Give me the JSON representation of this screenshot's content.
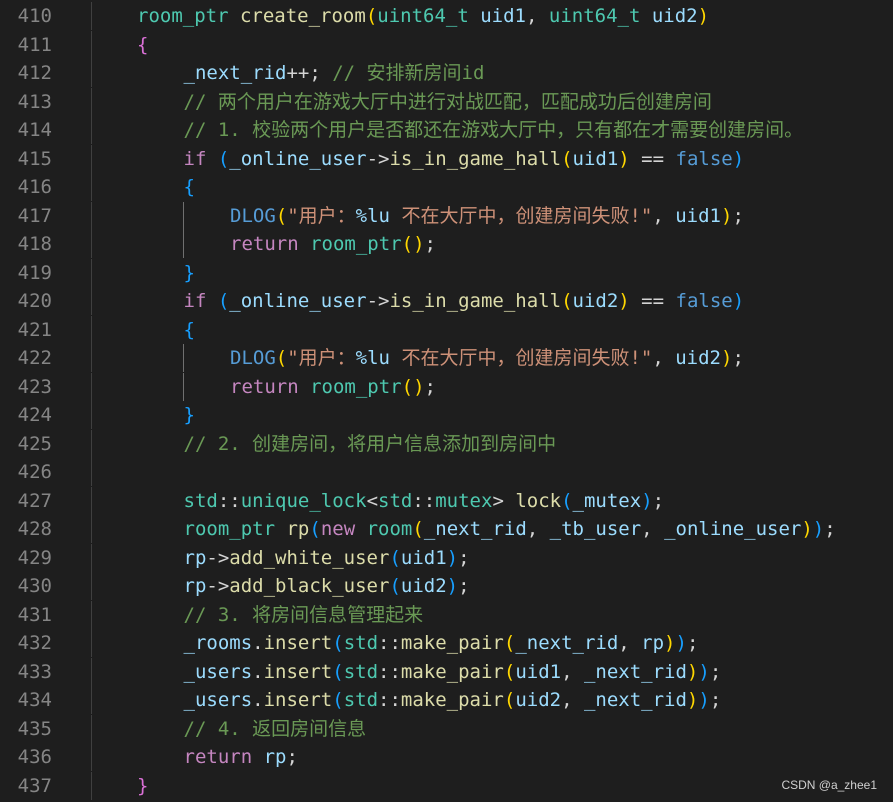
{
  "watermark": "CSDN @a_zhee1",
  "lines": [
    {
      "n": "410",
      "indent": 0,
      "tokens": [
        [
          "room_ptr",
          "type"
        ],
        [
          " ",
          "op"
        ],
        [
          "create_room",
          "func"
        ],
        [
          "(",
          "b1"
        ],
        [
          "uint64_t",
          "type"
        ],
        [
          " ",
          "op"
        ],
        [
          "uid1",
          "var"
        ],
        [
          ", ",
          "op"
        ],
        [
          "uint64_t",
          "type"
        ],
        [
          " ",
          "op"
        ],
        [
          "uid2",
          "var"
        ],
        [
          ")",
          "b1"
        ]
      ]
    },
    {
      "n": "411",
      "indent": 0,
      "tokens": [
        [
          "{",
          "b2"
        ]
      ]
    },
    {
      "n": "412",
      "indent": 1,
      "tokens": [
        [
          "_next_rid",
          "var"
        ],
        [
          "++; ",
          "op"
        ],
        [
          "// 安排新房间id",
          "cmt"
        ]
      ]
    },
    {
      "n": "413",
      "indent": 1,
      "tokens": [
        [
          "// 两个用户在游戏大厅中进行对战匹配，匹配成功后创建房间",
          "cmt"
        ]
      ]
    },
    {
      "n": "414",
      "indent": 1,
      "tokens": [
        [
          "// 1. 校验两个用户是否都还在游戏大厅中，只有都在才需要创建房间。",
          "cmt"
        ]
      ]
    },
    {
      "n": "415",
      "indent": 1,
      "tokens": [
        [
          "if",
          "kw"
        ],
        [
          " ",
          "op"
        ],
        [
          "(",
          "b3"
        ],
        [
          "_online_user",
          "var"
        ],
        [
          "->",
          "op"
        ],
        [
          "is_in_game_hall",
          "func"
        ],
        [
          "(",
          "b1"
        ],
        [
          "uid1",
          "var"
        ],
        [
          ")",
          "b1"
        ],
        [
          " == ",
          "op"
        ],
        [
          "false",
          "bool"
        ],
        [
          ")",
          "b3"
        ]
      ]
    },
    {
      "n": "416",
      "indent": 1,
      "tokens": [
        [
          "{",
          "b3"
        ]
      ]
    },
    {
      "n": "417",
      "indent": 2,
      "tokens": [
        [
          "DLOG",
          "macro"
        ],
        [
          "(",
          "b1"
        ],
        [
          "\"用户：",
          "str"
        ],
        [
          "%lu",
          "fmt"
        ],
        [
          " 不在大厅中，创建房间失败!\"",
          "str"
        ],
        [
          ", ",
          "op"
        ],
        [
          "uid1",
          "var"
        ],
        [
          ")",
          "b1"
        ],
        [
          ";",
          "op"
        ]
      ]
    },
    {
      "n": "418",
      "indent": 2,
      "tokens": [
        [
          "return",
          "kw"
        ],
        [
          " ",
          "op"
        ],
        [
          "room_ptr",
          "type"
        ],
        [
          "(",
          "b1"
        ],
        [
          ")",
          "b1"
        ],
        [
          ";",
          "op"
        ]
      ]
    },
    {
      "n": "419",
      "indent": 1,
      "tokens": [
        [
          "}",
          "b3"
        ]
      ]
    },
    {
      "n": "420",
      "indent": 1,
      "tokens": [
        [
          "if",
          "kw"
        ],
        [
          " ",
          "op"
        ],
        [
          "(",
          "b3"
        ],
        [
          "_online_user",
          "var"
        ],
        [
          "->",
          "op"
        ],
        [
          "is_in_game_hall",
          "func"
        ],
        [
          "(",
          "b1"
        ],
        [
          "uid2",
          "var"
        ],
        [
          ")",
          "b1"
        ],
        [
          " == ",
          "op"
        ],
        [
          "false",
          "bool"
        ],
        [
          ")",
          "b3"
        ]
      ]
    },
    {
      "n": "421",
      "indent": 1,
      "tokens": [
        [
          "{",
          "b3"
        ]
      ]
    },
    {
      "n": "422",
      "indent": 2,
      "tokens": [
        [
          "DLOG",
          "macro"
        ],
        [
          "(",
          "b1"
        ],
        [
          "\"用户：",
          "str"
        ],
        [
          "%lu",
          "fmt"
        ],
        [
          " 不在大厅中，创建房间失败!\"",
          "str"
        ],
        [
          ", ",
          "op"
        ],
        [
          "uid2",
          "var"
        ],
        [
          ")",
          "b1"
        ],
        [
          ";",
          "op"
        ]
      ]
    },
    {
      "n": "423",
      "indent": 2,
      "tokens": [
        [
          "return",
          "kw"
        ],
        [
          " ",
          "op"
        ],
        [
          "room_ptr",
          "type"
        ],
        [
          "(",
          "b1"
        ],
        [
          ")",
          "b1"
        ],
        [
          ";",
          "op"
        ]
      ]
    },
    {
      "n": "424",
      "indent": 1,
      "tokens": [
        [
          "}",
          "b3"
        ]
      ]
    },
    {
      "n": "425",
      "indent": 1,
      "tokens": [
        [
          "// 2. 创建房间，将用户信息添加到房间中",
          "cmt"
        ]
      ]
    },
    {
      "n": "426",
      "indent": 1,
      "tokens": []
    },
    {
      "n": "427",
      "indent": 1,
      "tokens": [
        [
          "std",
          "type"
        ],
        [
          "::",
          "op"
        ],
        [
          "unique_lock",
          "type"
        ],
        [
          "<",
          "op"
        ],
        [
          "std",
          "type"
        ],
        [
          "::",
          "op"
        ],
        [
          "mutex",
          "type"
        ],
        [
          "> ",
          "op"
        ],
        [
          "lock",
          "func"
        ],
        [
          "(",
          "b3"
        ],
        [
          "_mutex",
          "var"
        ],
        [
          ")",
          "b3"
        ],
        [
          ";",
          "op"
        ]
      ]
    },
    {
      "n": "428",
      "indent": 1,
      "tokens": [
        [
          "room_ptr",
          "type"
        ],
        [
          " ",
          "op"
        ],
        [
          "rp",
          "func"
        ],
        [
          "(",
          "b3"
        ],
        [
          "new",
          "kw"
        ],
        [
          " ",
          "op"
        ],
        [
          "room",
          "type"
        ],
        [
          "(",
          "b1"
        ],
        [
          "_next_rid",
          "var"
        ],
        [
          ", ",
          "op"
        ],
        [
          "_tb_user",
          "var"
        ],
        [
          ", ",
          "op"
        ],
        [
          "_online_user",
          "var"
        ],
        [
          ")",
          "b1"
        ],
        [
          ")",
          "b3"
        ],
        [
          ";",
          "op"
        ]
      ]
    },
    {
      "n": "429",
      "indent": 1,
      "tokens": [
        [
          "rp",
          "var"
        ],
        [
          "->",
          "op"
        ],
        [
          "add_white_user",
          "func"
        ],
        [
          "(",
          "b3"
        ],
        [
          "uid1",
          "var"
        ],
        [
          ")",
          "b3"
        ],
        [
          ";",
          "op"
        ]
      ]
    },
    {
      "n": "430",
      "indent": 1,
      "tokens": [
        [
          "rp",
          "var"
        ],
        [
          "->",
          "op"
        ],
        [
          "add_black_user",
          "func"
        ],
        [
          "(",
          "b3"
        ],
        [
          "uid2",
          "var"
        ],
        [
          ")",
          "b3"
        ],
        [
          ";",
          "op"
        ]
      ]
    },
    {
      "n": "431",
      "indent": 1,
      "tokens": [
        [
          "// 3. 将房间信息管理起来",
          "cmt"
        ]
      ]
    },
    {
      "n": "432",
      "indent": 1,
      "tokens": [
        [
          "_rooms",
          "var"
        ],
        [
          ".",
          "op"
        ],
        [
          "insert",
          "func"
        ],
        [
          "(",
          "b3"
        ],
        [
          "std",
          "type"
        ],
        [
          "::",
          "op"
        ],
        [
          "make_pair",
          "func"
        ],
        [
          "(",
          "b1"
        ],
        [
          "_next_rid",
          "var"
        ],
        [
          ", ",
          "op"
        ],
        [
          "rp",
          "var"
        ],
        [
          ")",
          "b1"
        ],
        [
          ")",
          "b3"
        ],
        [
          ";",
          "op"
        ]
      ]
    },
    {
      "n": "433",
      "indent": 1,
      "tokens": [
        [
          "_users",
          "var"
        ],
        [
          ".",
          "op"
        ],
        [
          "insert",
          "func"
        ],
        [
          "(",
          "b3"
        ],
        [
          "std",
          "type"
        ],
        [
          "::",
          "op"
        ],
        [
          "make_pair",
          "func"
        ],
        [
          "(",
          "b1"
        ],
        [
          "uid1",
          "var"
        ],
        [
          ", ",
          "op"
        ],
        [
          "_next_rid",
          "var"
        ],
        [
          ")",
          "b1"
        ],
        [
          ")",
          "b3"
        ],
        [
          ";",
          "op"
        ]
      ]
    },
    {
      "n": "434",
      "indent": 1,
      "tokens": [
        [
          "_users",
          "var"
        ],
        [
          ".",
          "op"
        ],
        [
          "insert",
          "func"
        ],
        [
          "(",
          "b3"
        ],
        [
          "std",
          "type"
        ],
        [
          "::",
          "op"
        ],
        [
          "make_pair",
          "func"
        ],
        [
          "(",
          "b1"
        ],
        [
          "uid2",
          "var"
        ],
        [
          ", ",
          "op"
        ],
        [
          "_next_rid",
          "var"
        ],
        [
          ")",
          "b1"
        ],
        [
          ")",
          "b3"
        ],
        [
          ";",
          "op"
        ]
      ]
    },
    {
      "n": "435",
      "indent": 1,
      "tokens": [
        [
          "// 4. 返回房间信息",
          "cmt"
        ]
      ]
    },
    {
      "n": "436",
      "indent": 1,
      "tokens": [
        [
          "return",
          "kw"
        ],
        [
          " ",
          "op"
        ],
        [
          "rp",
          "var"
        ],
        [
          ";",
          "op"
        ]
      ]
    },
    {
      "n": "437",
      "indent": 0,
      "tokens": [
        [
          "}",
          "b2"
        ]
      ]
    }
  ]
}
